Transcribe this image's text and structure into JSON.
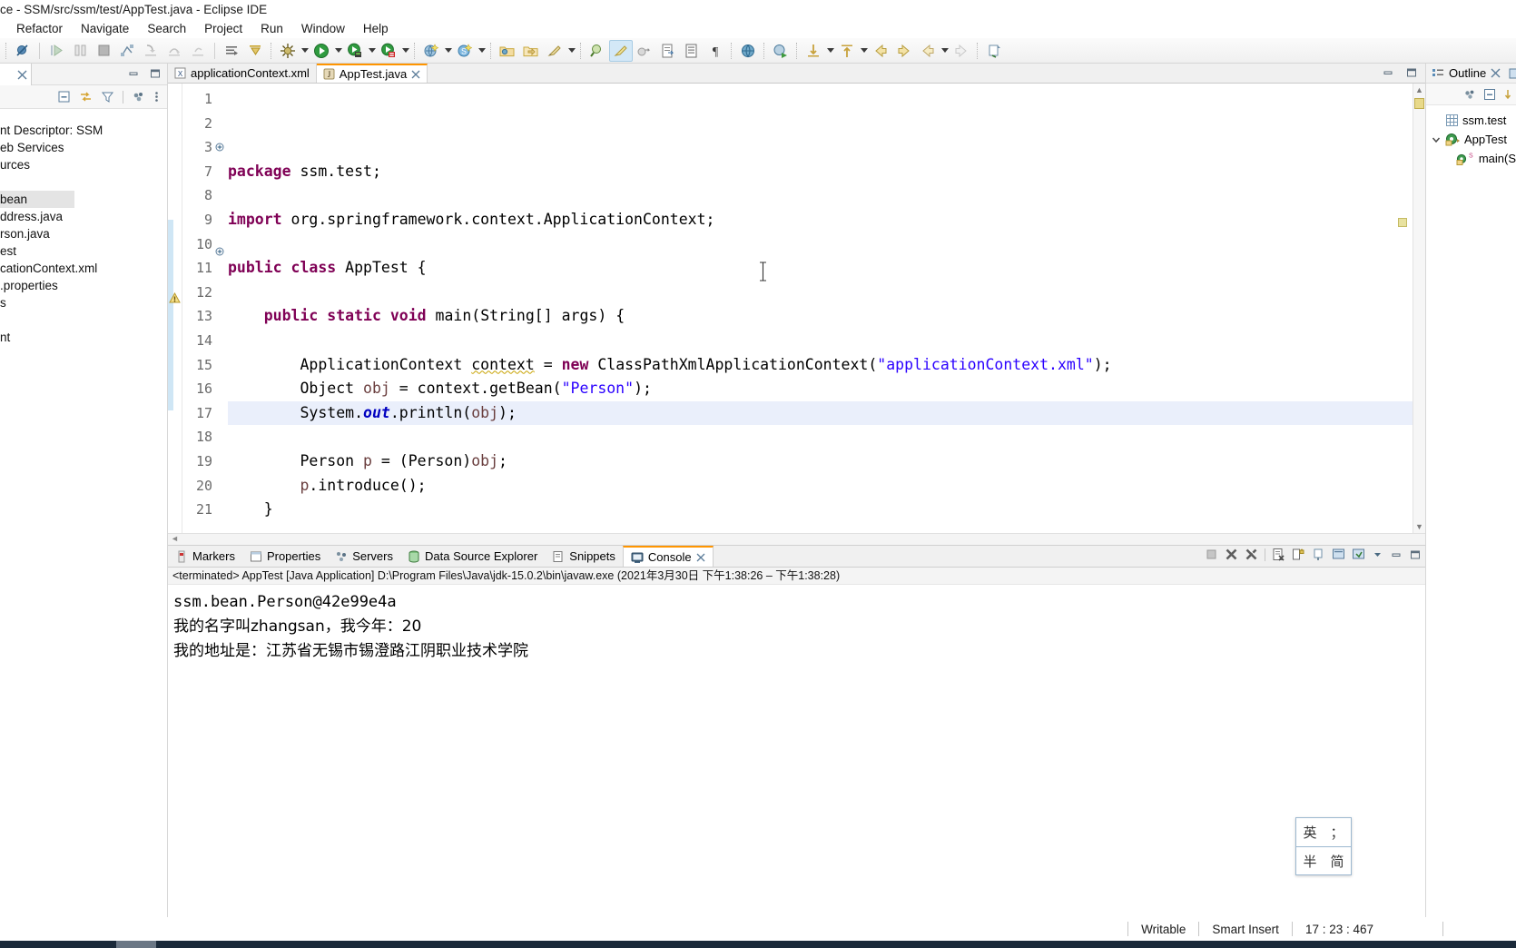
{
  "window": {
    "title": "ce - SSM/src/ssm/test/AppTest.java - Eclipse IDE"
  },
  "menubar": {
    "items": [
      "Refactor",
      "Navigate",
      "Search",
      "Project",
      "Run",
      "Window",
      "Help"
    ]
  },
  "toolbar": {
    "icons": [
      "skip-breakpoints-icon",
      "resume-icon",
      "suspend-icon",
      "terminate-icon",
      "disconnect-icon",
      "step-into-icon",
      "step-over-icon",
      "step-return-icon",
      "open-type-icon",
      "next-annotation-icon",
      "debug-icon",
      "run-icon",
      "run-external-tools-icon",
      "run-server-icon",
      "new-java-project-icon",
      "new-spring-icon",
      "new-wizard-icon",
      "open-folder-icon",
      "save-icon",
      "print-icon",
      "search-icon",
      "marker-icon",
      "build-all-icon",
      "open-task-icon",
      "show-whitespace-icon",
      "pilcrow-icon",
      "web-browser-icon",
      "debug-last-icon",
      "previous-edit-icon",
      "next-edit-icon",
      "back-icon",
      "forward-icon",
      "pin-icon"
    ]
  },
  "package_explorer": {
    "toolbar_icons": [
      "collapse-all-icon",
      "link-with-editor-icon",
      "filter-icon",
      "view-menu-icon",
      "view-more-icon"
    ],
    "tree": [
      {
        "label": "nt Descriptor: SSM",
        "selected": false
      },
      {
        "label": "eb Services",
        "selected": false
      },
      {
        "label": "urces",
        "selected": false
      },
      {
        "label": "",
        "selected": false
      },
      {
        "label": "bean",
        "selected": true
      },
      {
        "label": "ddress.java",
        "selected": false
      },
      {
        "label": "rson.java",
        "selected": false
      },
      {
        "label": "est",
        "selected": false
      },
      {
        "label": "cationContext.xml",
        "selected": false
      },
      {
        "label": ".properties",
        "selected": false
      },
      {
        "label": "s",
        "selected": false
      },
      {
        "label": "",
        "selected": false
      },
      {
        "label": "nt",
        "selected": false
      }
    ]
  },
  "editor": {
    "tabs": [
      {
        "label": "AppTest.java",
        "icon": "java-file-icon",
        "active": true,
        "closable": true
      },
      {
        "label": "applicationContext.xml",
        "icon": "xml-file-icon",
        "active": false,
        "closable": false
      }
    ],
    "current_line": 17,
    "lines": [
      {
        "num": "1",
        "fold": "",
        "text": "package ssm.test;"
      },
      {
        "num": "2",
        "fold": "",
        "text": ""
      },
      {
        "num": "3",
        "fold": "collapse",
        "text": "import org.springframework.context.ApplicationContext;"
      },
      {
        "num": "7",
        "fold": "",
        "text": ""
      },
      {
        "num": "8",
        "fold": "",
        "text": "public class AppTest {"
      },
      {
        "num": "9",
        "fold": "",
        "text": ""
      },
      {
        "num": "10",
        "fold": "collapse",
        "text": "    public static void main(String[] args) {"
      },
      {
        "num": "11",
        "fold": "",
        "text": ""
      },
      {
        "num": "12",
        "fold": "",
        "text": "        ApplicationContext context = new ClassPathXmlApplicationContext(\"applicationContext.xml\");"
      },
      {
        "num": "13",
        "fold": "",
        "text": "        Object obj = context.getBean(\"Person\");"
      },
      {
        "num": "14",
        "fold": "",
        "text": "        System.out.println(obj);"
      },
      {
        "num": "15",
        "fold": "",
        "text": ""
      },
      {
        "num": "16",
        "fold": "",
        "text": "        Person p = (Person)obj;"
      },
      {
        "num": "17",
        "fold": "",
        "text": "        p.introduce();"
      },
      {
        "num": "18",
        "fold": "",
        "text": "    }"
      },
      {
        "num": "19",
        "fold": "",
        "text": ""
      },
      {
        "num": "20",
        "fold": "",
        "text": "}"
      },
      {
        "num": "21",
        "fold": "",
        "text": ""
      }
    ]
  },
  "outline": {
    "title": "Outline",
    "icon": "outline-icon",
    "toolbar_icons": [
      "sort-icon",
      "collapse-all-icon",
      "filter-icon"
    ],
    "items": [
      {
        "label": "ssm.test",
        "icon": "package-icon",
        "indent": 0,
        "expander": ""
      },
      {
        "label": "AppTest",
        "icon": "class-icon",
        "indent": 0,
        "expander": "expanded"
      },
      {
        "label": "main(S",
        "icon": "method-static-icon",
        "indent": 1,
        "expander": ""
      }
    ]
  },
  "console": {
    "tabs": [
      {
        "label": "Markers",
        "icon": "markers-icon",
        "active": false
      },
      {
        "label": "Properties",
        "icon": "properties-icon",
        "active": false
      },
      {
        "label": "Servers",
        "icon": "servers-icon",
        "active": false
      },
      {
        "label": "Data Source Explorer",
        "icon": "datasource-icon",
        "active": false
      },
      {
        "label": "Snippets",
        "icon": "snippets-icon",
        "active": false
      },
      {
        "label": "Console",
        "icon": "console-icon",
        "active": true
      }
    ],
    "toolbar_icons": [
      "terminate-icon",
      "remove-launch-icon",
      "remove-all-launches-icon",
      "clear-console-icon",
      "scroll-lock-icon",
      "pin-console-icon",
      "display-selected-console-icon",
      "open-console-icon",
      "view-menu-icon",
      "minimize-icon",
      "maximize-icon"
    ],
    "launch_header": "<terminated> AppTest [Java Application] D:\\Program Files\\Java\\jdk-15.0.2\\bin\\javaw.exe  (2021年3月30日 下午1:38:26 – 下午1:38:28)",
    "output": [
      "ssm.bean.Person@42e99e4a",
      "我的名字叫zhangsan，我今年：20",
      "我的地址是：江苏省无锡市锡澄路江阴职业技术学院"
    ]
  },
  "ime": {
    "row1": [
      "英",
      "；"
    ],
    "row2": [
      "半",
      "简"
    ]
  },
  "statusbar": {
    "writable": "Writable",
    "insert_mode": "Smart Insert",
    "position": "17 : 23 : 467"
  },
  "colors": {
    "keyword": "#7f0055",
    "string": "#2a00ff",
    "field": "#6a3e3e",
    "current_line": "#eaeffb",
    "tab_active_top": "#ff9500"
  }
}
